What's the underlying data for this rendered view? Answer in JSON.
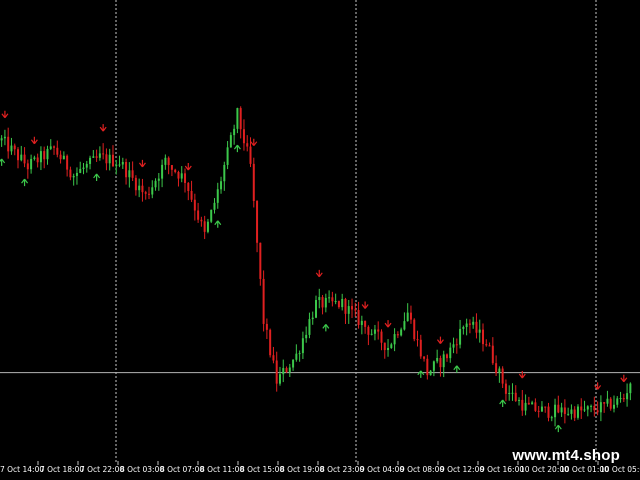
{
  "watermark": "www.mt4.shop",
  "colors": {
    "background": "#000000",
    "bull": "#3cc84b",
    "bear": "#e02020",
    "grid": "#c8c8c8",
    "price_line": "#b4b4b4",
    "text": "#ffffff",
    "arrow_up": "#3cc84b",
    "arrow_down": "#e02020"
  },
  "chart_data": {
    "type": "candlestick",
    "title": "",
    "xlabel": "",
    "ylabel": "",
    "grid": "vertical dashed",
    "x_tick_labels": [
      "7 Oct 14:00",
      "7 Oct 18:00",
      "7 Oct 22:00",
      "8 Oct 03:00",
      "8 Oct 07:00",
      "8 Oct 11:00",
      "8 Oct 15:00",
      "8 Oct 19:00",
      "8 Oct 23:00",
      "9 Oct 04:00",
      "9 Oct 08:00",
      "9 Oct 12:00",
      "9 Oct 16:00",
      "10 Oct 20:00",
      "10 Oct 01:00",
      "10 Oct 05:00"
    ],
    "vertical_grid_at": [
      "7 Oct 22:00",
      "8 Oct 23:00",
      "10 Oct 01:00"
    ],
    "ylim": [
      0,
      100
    ],
    "current_price_level": 18,
    "price_path": [
      {
        "bar": 0,
        "level": 72
      },
      {
        "bar": 8,
        "level": 66
      },
      {
        "bar": 16,
        "level": 70
      },
      {
        "bar": 22,
        "level": 64
      },
      {
        "bar": 30,
        "level": 68
      },
      {
        "bar": 36,
        "level": 67
      },
      {
        "bar": 44,
        "level": 59
      },
      {
        "bar": 50,
        "level": 67
      },
      {
        "bar": 56,
        "level": 63
      },
      {
        "bar": 62,
        "level": 50
      },
      {
        "bar": 66,
        "level": 60
      },
      {
        "bar": 72,
        "level": 78
      },
      {
        "bar": 76,
        "level": 66
      },
      {
        "bar": 80,
        "level": 30
      },
      {
        "bar": 84,
        "level": 16
      },
      {
        "bar": 90,
        "level": 22
      },
      {
        "bar": 96,
        "level": 34
      },
      {
        "bar": 104,
        "level": 34
      },
      {
        "bar": 112,
        "level": 28
      },
      {
        "bar": 118,
        "level": 24
      },
      {
        "bar": 124,
        "level": 32
      },
      {
        "bar": 130,
        "level": 18
      },
      {
        "bar": 136,
        "level": 22
      },
      {
        "bar": 142,
        "level": 30
      },
      {
        "bar": 148,
        "level": 25
      },
      {
        "bar": 154,
        "level": 14
      },
      {
        "bar": 160,
        "level": 10
      },
      {
        "bar": 166,
        "level": 9
      },
      {
        "bar": 172,
        "level": 9
      },
      {
        "bar": 178,
        "level": 9
      },
      {
        "bar": 184,
        "level": 10
      },
      {
        "bar": 190,
        "level": 12
      },
      {
        "bar": 192,
        "level": 16
      }
    ],
    "bars": 193,
    "up_arrow_bars": [
      0,
      7,
      29,
      66,
      72,
      99,
      128,
      139,
      153,
      170
    ],
    "down_arrow_bars": [
      1,
      10,
      31,
      43,
      57,
      77,
      97,
      111,
      118,
      134,
      159,
      182,
      190
    ]
  }
}
